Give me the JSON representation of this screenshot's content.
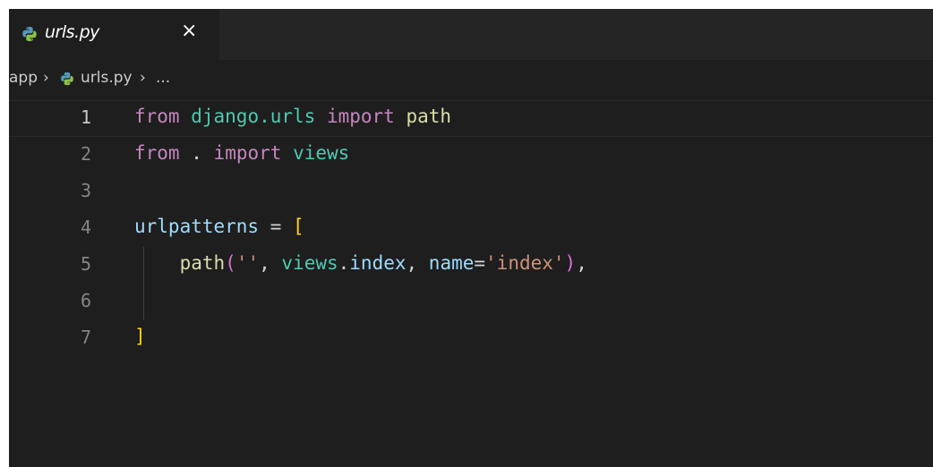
{
  "tab": {
    "title": "urls.py",
    "close_label": "×",
    "icon": "python-icon"
  },
  "breadcrumb": {
    "folder": "app",
    "sep1": "›",
    "file": "urls.py",
    "sep2": "›",
    "symbol": "..."
  },
  "editor": {
    "lines": [
      {
        "number": "1",
        "text": "from django.urls import path"
      },
      {
        "number": "2",
        "text": "from . import views"
      },
      {
        "number": "3",
        "text": ""
      },
      {
        "number": "4",
        "text": "urlpatterns = ["
      },
      {
        "number": "5",
        "text": "    path('', views.index, name='index'),"
      },
      {
        "number": "6",
        "text": ""
      },
      {
        "number": "7",
        "text": "]"
      }
    ],
    "active_line": "1"
  },
  "colors": {
    "background": "#1e1e1e",
    "tabbar": "#252526",
    "keyword": "#c586c0",
    "module": "#4ec9b0",
    "function": "#dcdcaa",
    "variable": "#9cdcfe",
    "string": "#ce9178",
    "bracket": "#ffd700",
    "paren": "#da70d6"
  }
}
